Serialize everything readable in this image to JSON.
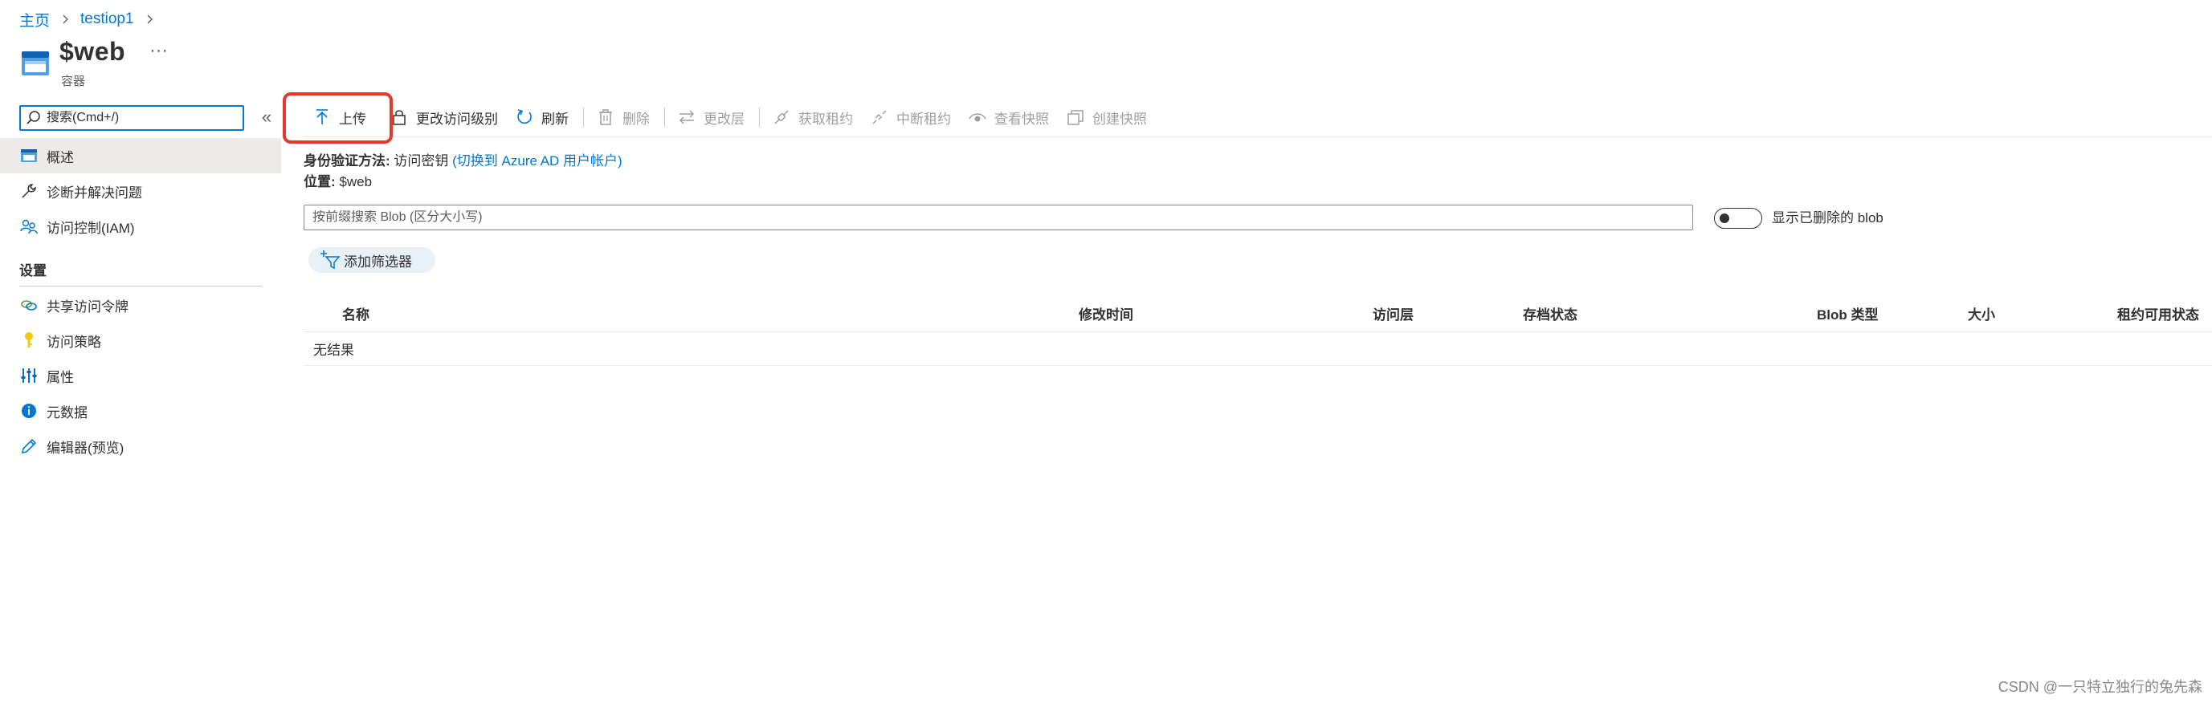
{
  "breadcrumb": {
    "home": "主页",
    "resource": "testiop1"
  },
  "header": {
    "title": "$web",
    "subtitle": "容器",
    "more": "···",
    "icon": "container-icon"
  },
  "sidebar": {
    "search_placeholder": "搜索(Cmd+/)",
    "collapse": "«",
    "items": [
      {
        "label": "概述",
        "icon": "overview-icon",
        "selected": true
      },
      {
        "label": "诊断并解决问题",
        "icon": "wrench-icon"
      },
      {
        "label": "访问控制(IAM)",
        "icon": "people-icon"
      }
    ],
    "section_settings": "设置",
    "settings_items": [
      {
        "label": "共享访问令牌",
        "icon": "link-icon"
      },
      {
        "label": "访问策略",
        "icon": "key-icon"
      },
      {
        "label": "属性",
        "icon": "sliders-icon"
      },
      {
        "label": "元数据",
        "icon": "info-icon"
      },
      {
        "label": "编辑器(预览)",
        "icon": "pencil-icon"
      }
    ]
  },
  "toolbar": {
    "upload": "上传",
    "change_access_level": "更改访问级别",
    "refresh": "刷新",
    "delete": "删除",
    "change_tier": "更改层",
    "acquire_lease": "获取租约",
    "break_lease": "中断租约",
    "view_snapshots": "查看快照",
    "create_snapshot": "创建快照"
  },
  "info": {
    "auth_label": "身份验证方法:",
    "auth_value": "访问密钥",
    "auth_link": "(切换到 Azure AD 用户帐户)",
    "location_label": "位置:",
    "location_value": "$web"
  },
  "blob_search": {
    "placeholder": "按前缀搜索 Blob (区分大小写)"
  },
  "toggle": {
    "label": "显示已删除的 blob",
    "on": false
  },
  "filter": {
    "label": "添加筛选器"
  },
  "table": {
    "columns": [
      "名称",
      "修改时间",
      "访问层",
      "存档状态",
      "Blob 类型",
      "大小",
      "租约可用状态"
    ],
    "empty_text": "无结果"
  },
  "watermark": "CSDN @一只特立独行的兔先森",
  "colors": {
    "accent": "#0078d4",
    "highlight": "#e23b2e",
    "selected_bg": "#edebe9"
  }
}
